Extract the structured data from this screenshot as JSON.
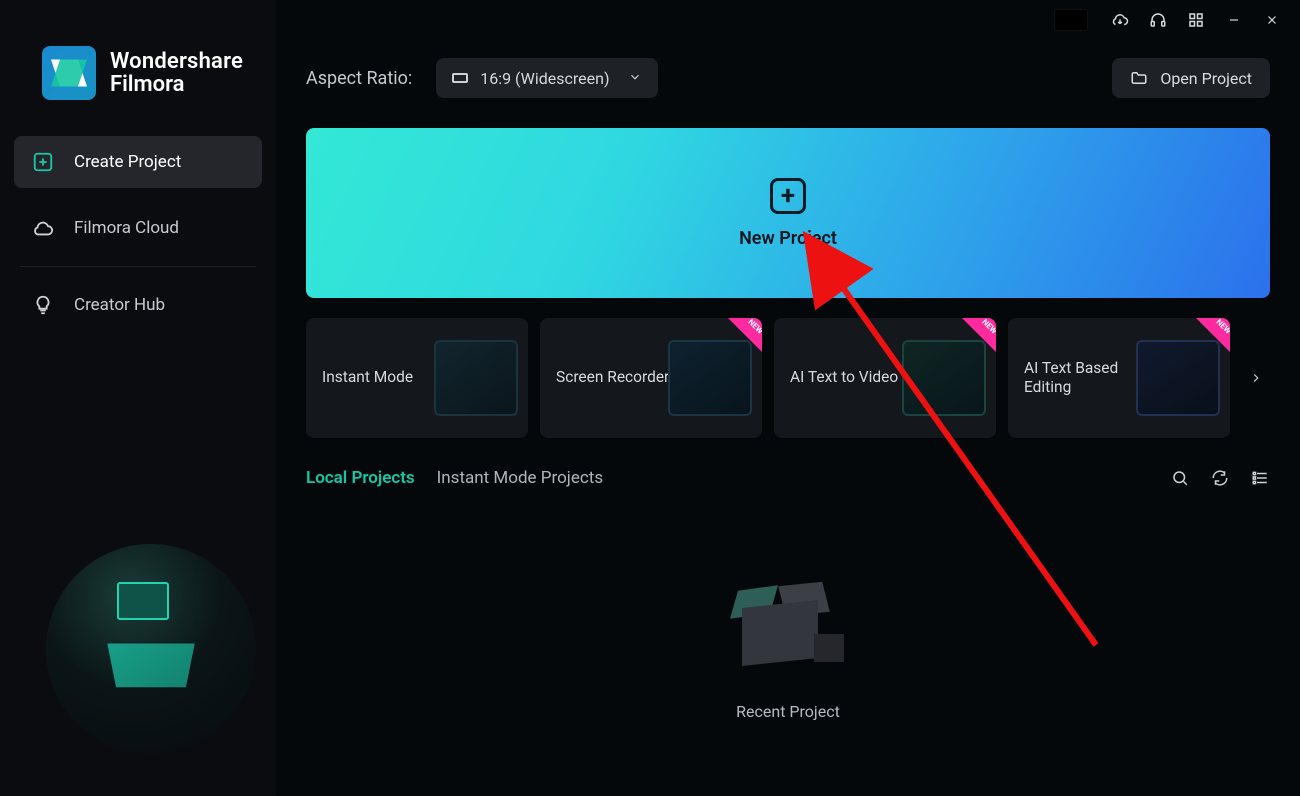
{
  "app": {
    "brand_line1": "Wondershare",
    "brand_line2": "Filmora"
  },
  "sidebar": {
    "items": [
      {
        "label": "Create Project",
        "icon": "plus-square-icon",
        "active": true
      },
      {
        "label": "Filmora Cloud",
        "icon": "cloud-icon",
        "active": false
      },
      {
        "label": "Creator Hub",
        "icon": "lightbulb-icon",
        "active": false
      }
    ]
  },
  "topbar": {
    "aspect_ratio_label": "Aspect Ratio:",
    "aspect_ratio_value": "16:9 (Widescreen)",
    "open_project_label": "Open Project"
  },
  "hero": {
    "new_project_label": "New Project"
  },
  "cards": [
    {
      "title": "Instant Mode",
      "new": false
    },
    {
      "title": "Screen Recorder",
      "new": true
    },
    {
      "title": "AI Text to Video",
      "new": true
    },
    {
      "title": "AI Text Based Editing",
      "new": true
    }
  ],
  "tabs": [
    {
      "label": "Local Projects",
      "active": true
    },
    {
      "label": "Instant Mode Projects",
      "active": false
    }
  ],
  "recent": {
    "label": "Recent Project"
  }
}
